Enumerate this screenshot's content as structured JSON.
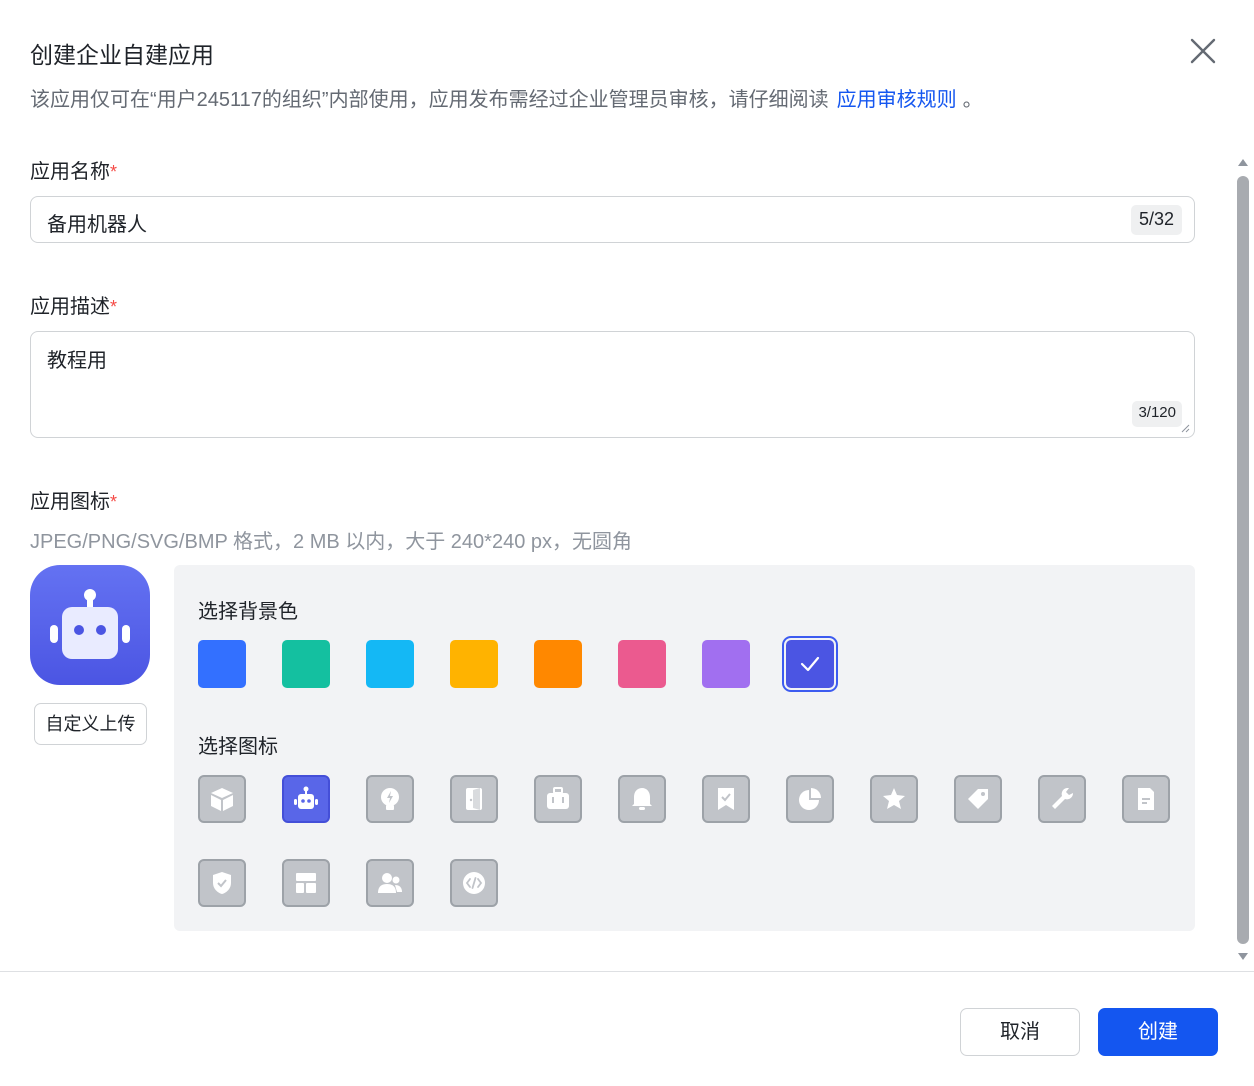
{
  "dialog": {
    "title": "创建企业自建应用",
    "subtitle_prefix": "该应用仅可在“用户245117的组织”内部使用，应用发布需经过企业管理员审核，请仔细阅读",
    "subtitle_link": "应用审核规则",
    "subtitle_suffix": "。"
  },
  "form": {
    "name_label": "应用名称",
    "required_mark": "*",
    "name_value": "备用机器人",
    "name_counter": "5/32",
    "desc_label": "应用描述",
    "desc_value": "教程用",
    "desc_counter": "3/120",
    "icon_label": "应用图标",
    "icon_hint": "JPEG/PNG/SVG/BMP 格式，2 MB 以内，大于 240*240 px，无圆角",
    "upload_button": "自定义上传"
  },
  "picker": {
    "bg_title": "选择背景色",
    "icon_title": "选择图标",
    "colors": [
      "#3370ff",
      "#14c0a0",
      "#14b8f5",
      "#ffb300",
      "#ff8800",
      "#eb5a8f",
      "#a16ff0",
      "#4b55e3"
    ],
    "selected_color_index": 7,
    "icons": [
      "box-icon",
      "robot-icon",
      "bulb-icon",
      "door-icon",
      "briefcase-icon",
      "bell-icon",
      "bookmark-icon",
      "pie-chart-icon",
      "star-icon",
      "tag-icon",
      "wrench-icon",
      "document-icon",
      "shield-icon",
      "layout-icon",
      "people-icon",
      "code-icon"
    ],
    "selected_icon_index": 1
  },
  "footer": {
    "cancel_label": "取消",
    "create_label": "创建"
  }
}
